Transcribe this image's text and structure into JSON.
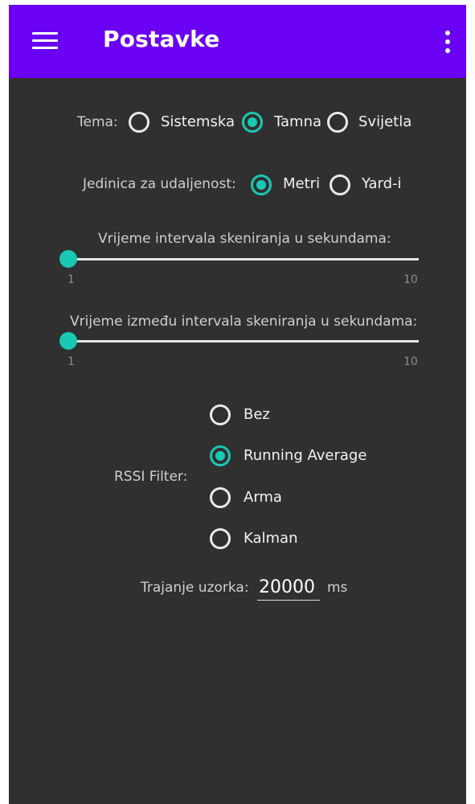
{
  "app_bar": {
    "title": "Postavke",
    "menu_icon": "hamburger-menu-icon",
    "overflow_icon": "more-vert-icon",
    "color": "#6a00f4"
  },
  "theme": {
    "label": "Tema:",
    "options": [
      {
        "label": "Sistemska",
        "selected": false
      },
      {
        "label": "Tamna",
        "selected": true
      },
      {
        "label": "Svijetla",
        "selected": false
      }
    ]
  },
  "distance_unit": {
    "label": "Jedinica za udaljenost:",
    "options": [
      {
        "label": "Metri",
        "selected": true
      },
      {
        "label": "Yard-i",
        "selected": false
      }
    ]
  },
  "scan_interval": {
    "label": "Vrijeme intervala skeniranja u sekundama:",
    "min": "1",
    "max": "10",
    "value": 1
  },
  "scan_gap": {
    "label": "Vrijeme između intervala skeniranja u sekundama:",
    "min": "1",
    "max": "10",
    "value": 1
  },
  "rssi_filter": {
    "label": "RSSI Filter:",
    "options": [
      {
        "label": "Bez",
        "selected": false
      },
      {
        "label": "Running Average",
        "selected": true
      },
      {
        "label": "Arma",
        "selected": false
      },
      {
        "label": "Kalman",
        "selected": false
      }
    ]
  },
  "sample_duration": {
    "label": "Trajanje uzorka:",
    "value": "20000",
    "unit": "ms"
  },
  "colors": {
    "accent": "#19c9b4",
    "background": "#303030"
  }
}
